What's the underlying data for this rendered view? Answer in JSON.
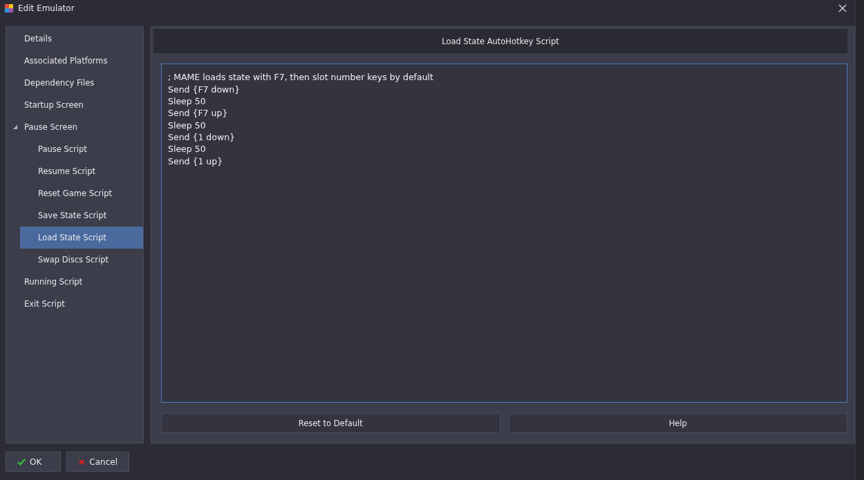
{
  "window": {
    "title": "Edit Emulator"
  },
  "sidebar": {
    "items": [
      {
        "label": "Details",
        "selected": false
      },
      {
        "label": "Associated Platforms",
        "selected": false
      },
      {
        "label": "Dependency Files",
        "selected": false
      },
      {
        "label": "Startup Screen",
        "selected": false
      },
      {
        "label": "Pause Screen",
        "selected": false,
        "expanded": true,
        "children": [
          {
            "label": "Pause Script",
            "selected": false
          },
          {
            "label": "Resume Script",
            "selected": false
          },
          {
            "label": "Reset Game Script",
            "selected": false
          },
          {
            "label": "Save State Script",
            "selected": false
          },
          {
            "label": "Load State Script",
            "selected": true
          },
          {
            "label": "Swap Discs Script",
            "selected": false
          }
        ]
      },
      {
        "label": "Running Script",
        "selected": false
      },
      {
        "label": "Exit Script",
        "selected": false
      }
    ]
  },
  "panel": {
    "title": "Load State AutoHotkey Script",
    "script": "; MAME loads state with F7, then slot number keys by default\nSend {F7 down}\nSleep 50\nSend {F7 up}\nSleep 50\nSend {1 down}\nSleep 50\nSend {1 up}",
    "buttons": [
      "Reset to Default",
      "Help"
    ]
  },
  "footer": {
    "buttons": [
      {
        "kind": "ok",
        "label": "OK"
      },
      {
        "kind": "cancel",
        "label": "Cancel"
      }
    ]
  }
}
